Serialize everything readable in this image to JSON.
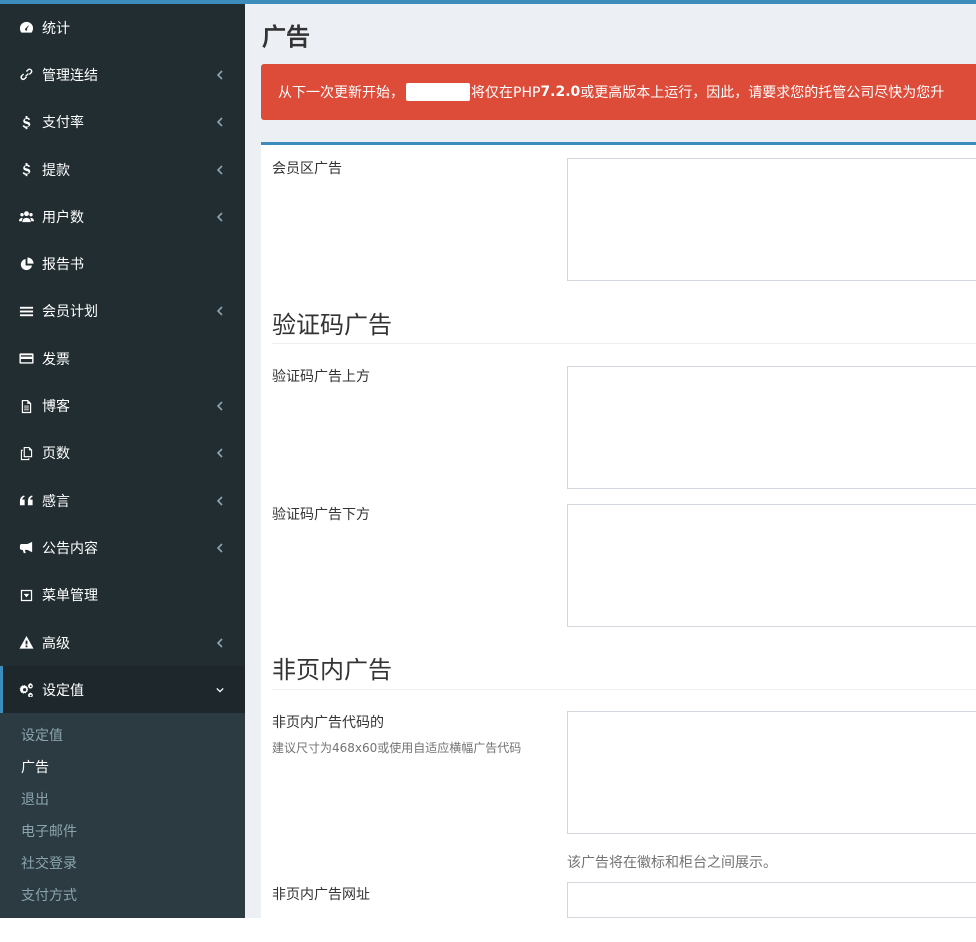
{
  "sidebar": {
    "items": [
      {
        "label": "统计",
        "icon": "dashboard-icon",
        "chevron": false
      },
      {
        "label": "管理连结",
        "icon": "link-icon",
        "chevron": true
      },
      {
        "label": "支付率",
        "icon": "dollar-icon",
        "chevron": true
      },
      {
        "label": "提款",
        "icon": "dollar-icon",
        "chevron": true
      },
      {
        "label": "用户数",
        "icon": "users-icon",
        "chevron": true
      },
      {
        "label": "报告书",
        "icon": "pie-chart-icon",
        "chevron": false
      },
      {
        "label": "会员计划",
        "icon": "bars-icon",
        "chevron": true
      },
      {
        "label": "发票",
        "icon": "credit-card-icon",
        "chevron": false
      },
      {
        "label": "博客",
        "icon": "file-text-icon",
        "chevron": true
      },
      {
        "label": "页数",
        "icon": "copy-icon",
        "chevron": true
      },
      {
        "label": "感言",
        "icon": "quote-icon",
        "chevron": true
      },
      {
        "label": "公告内容",
        "icon": "bullhorn-icon",
        "chevron": true
      },
      {
        "label": "菜单管理",
        "icon": "caret-square-icon",
        "chevron": false
      },
      {
        "label": "高级",
        "icon": "warning-icon",
        "chevron": true
      },
      {
        "label": "设定值",
        "icon": "cogs-icon",
        "chevron": true,
        "active": true
      }
    ],
    "submenu": [
      {
        "label": "设定值"
      },
      {
        "label": "广告",
        "current": true
      },
      {
        "label": "退出"
      },
      {
        "label": "电子邮件"
      },
      {
        "label": "社交登录"
      },
      {
        "label": "支付方式"
      }
    ]
  },
  "page": {
    "title": "广告",
    "alert": {
      "part1": "从下一次更新开始，",
      "part2": "将仅在PHP ",
      "version": "7.2.0",
      "part3": "或更高版本上运行，因此，请要求您的托管公司尽快为您升"
    }
  },
  "form": {
    "member_ad_label": "会员区广告",
    "captcha_section": "验证码广告",
    "captcha_top_label": "验证码广告上方",
    "captcha_bottom_label": "验证码广告下方",
    "offpage_section": "非页内广告",
    "offpage_code_label": "非页内广告代码的",
    "offpage_code_help": "建议尺寸为468x60或使用自适应横幅广告代码",
    "offpage_code_note": "该广告将在徽标和柜台之间展示。",
    "offpage_url_label": "非页内广告网址"
  },
  "colors": {
    "sidebar_bg": "#222d32",
    "submenu_bg": "#2c3b41",
    "accent": "#3c8dbc",
    "alert_bg": "#dd4b39",
    "content_bg": "#ecf0f5"
  }
}
